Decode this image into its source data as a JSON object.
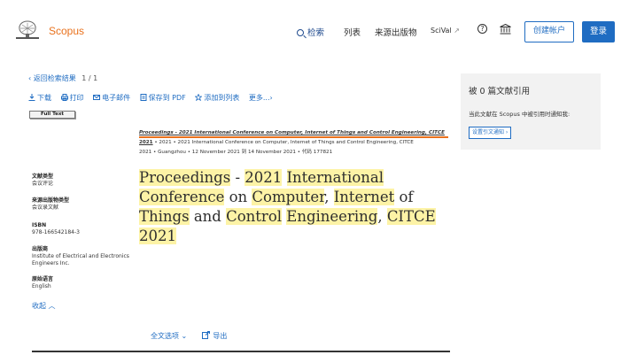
{
  "header": {
    "logo_text": "Scopus",
    "nav": {
      "search": "检索",
      "lists": "列表",
      "sources": "来源出版物",
      "scival": "SciVal",
      "scival_ext": "↗"
    },
    "create_account": "创建帐户",
    "login": "登录"
  },
  "breadcrumb": {
    "back": "‹ 返回检索结果",
    "pager": "1 / 1"
  },
  "toolbar": {
    "download": "下载",
    "print": "打印",
    "email": "电子邮件",
    "save_pdf": "保存到 PDF",
    "add_list": "添加到列表",
    "more": "更多...",
    "more_chevron": "›"
  },
  "full_text_button": "Full Text",
  "source": {
    "title": "Proceedings - 2021 International Conference on Computer, Internet of Things and Control Engineering, CITCE",
    "year": "2021",
    "line2": " • 2021 • 2021 International Conference on Computer, Internet of Things and Control Engineering, CITCE",
    "line3": "2021 • Guangzhou • 12 November 2021 到 14 November 2021 • 代码 177821"
  },
  "meta": {
    "doc_type_label": "文献类型",
    "doc_type_value": "会议评论",
    "source_type_label": "来源出版物类型",
    "source_type_value": "会议录文献",
    "isbn_label": "ISBN",
    "isbn_value": "978-166542184-3",
    "publisher_label": "出版商",
    "publisher_value": "Institute of Electrical and Electronics Engineers Inc.",
    "lang_label": "原始语言",
    "lang_value": "English",
    "collapse": "收起 ︿"
  },
  "title_parts": {
    "p1": "Proceedings",
    "p2": " - ",
    "p3": "2021",
    "p4": " ",
    "p5": "International",
    "p6": " ",
    "p7": "Conference",
    "p8": " on ",
    "p9": "Computer",
    "p10": ", ",
    "p11": "Internet",
    "p12": " of ",
    "p13": "Things",
    "p14": " and ",
    "p15": "Control",
    "p16": " ",
    "p17": "Engineering",
    "p18": ", ",
    "p19": "CITCE",
    "p20": " ",
    "p21": "2021"
  },
  "bottom": {
    "full_text_options": "全文选项 ⌄",
    "export": "导出"
  },
  "citations": {
    "title": "被 0 篇文献引用",
    "desc": "当此文献在 Scopus 中被引用时通知我:",
    "button": "设置引文通知 ›"
  },
  "colors": {
    "brand_orange": "#e9711c",
    "link_blue": "#1f6cc2",
    "highlight": "#fdf3a6",
    "panel_bg": "#f2f2f2"
  }
}
